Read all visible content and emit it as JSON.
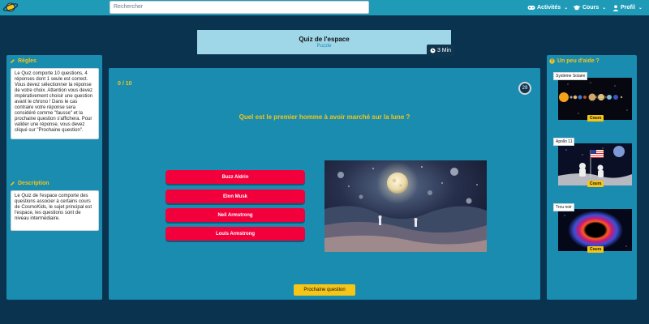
{
  "navbar": {
    "logo_icon": "planet-logo-icon",
    "search_placeholder": "Rechercher",
    "activities_label": "Activités",
    "courses_label": "Cours",
    "profile_label": "Profil"
  },
  "quiz": {
    "title": "Quiz de l'espace",
    "subtitle": "Puzzle",
    "duration": "3 Min",
    "score": "0 / 10",
    "countdown": "29",
    "question": "Quel est le premier homme à avoir marché sur la lune ?",
    "answers": [
      "Buzz Aldrin",
      "Elon Musk",
      "Neil Armstrong",
      "Louis Armstrong"
    ],
    "next_label": "Prochaine question"
  },
  "rules": {
    "heading": "Règles",
    "text": "Le Quiz comporte 10 questions, 4 réponses dont 1 seule est correct. Vous devez sélectionner la réponse de votre choix. Attention vous devez impérativement choisir une question avant le chrono ! Dans le cas contraire votre réponse sera considéré comme \"fausse\" et la prochaine question s'affichera. Pour valider une réponse, vous devez cliqué sur \"Prochaine question\"."
  },
  "description": {
    "heading": "Description",
    "text": "Le Quiz de l'espace comporte des questions associer à certains cours de CosmoKids, le sujet principal est l'espace, les questions sont de niveau intermédiaire."
  },
  "help": {
    "heading": "Un peu d'aide ?",
    "cards": [
      {
        "label": "Système Solaire",
        "button": "Cours"
      },
      {
        "label": "Apollo 11",
        "button": "Cours"
      },
      {
        "label": "Trou noir",
        "button": "Cours"
      }
    ]
  },
  "colors": {
    "background": "#0a3350",
    "navbar": "#1f9bb7",
    "panel": "#1a8cb0",
    "accent_yellow": "#f5c518",
    "answer_red": "#f2003c",
    "title_card": "#9fd6e8"
  }
}
